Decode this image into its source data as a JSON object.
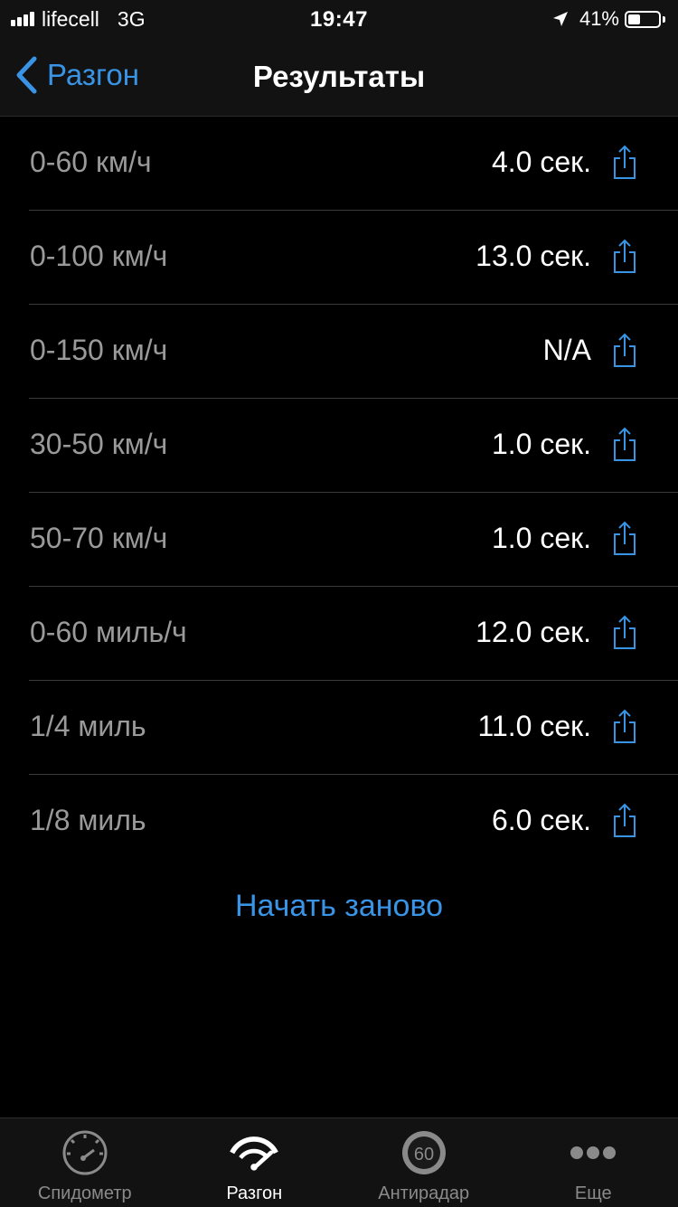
{
  "status_bar": {
    "carrier": "lifecell",
    "network": "3G",
    "time": "19:47",
    "battery": "41%",
    "battery_level": 0.41,
    "signal_bars": 4
  },
  "nav": {
    "back_label": "Разгон",
    "title": "Результаты"
  },
  "results": [
    {
      "label": "0-60 км/ч",
      "value": "4.0 сек."
    },
    {
      "label": "0-100 км/ч",
      "value": "13.0 сек."
    },
    {
      "label": "0-150 км/ч",
      "value": "N/A"
    },
    {
      "label": "30-50 км/ч",
      "value": "1.0 сек."
    },
    {
      "label": "50-70 км/ч",
      "value": "1.0 сек."
    },
    {
      "label": "0-60 миль/ч",
      "value": "12.0 сек."
    },
    {
      "label": "1/4 миль",
      "value": "11.0 сек."
    },
    {
      "label": "1/8 миль",
      "value": "6.0 сек."
    }
  ],
  "restart_label": "Начать заново",
  "tabs": [
    {
      "label": "Спидометр",
      "icon": "speedometer-icon",
      "active": false
    },
    {
      "label": "Разгон",
      "icon": "acceleration-gauge-icon",
      "active": true
    },
    {
      "label": "Антирадар",
      "icon": "speed-limit-60-icon",
      "icon_text": "60",
      "active": false
    },
    {
      "label": "Еще",
      "icon": "more-dots-icon",
      "active": false
    }
  ],
  "colors": {
    "accent": "#3a94e6",
    "background": "#000000",
    "bar_background": "#121212",
    "label_gray": "#9a9a9a"
  }
}
